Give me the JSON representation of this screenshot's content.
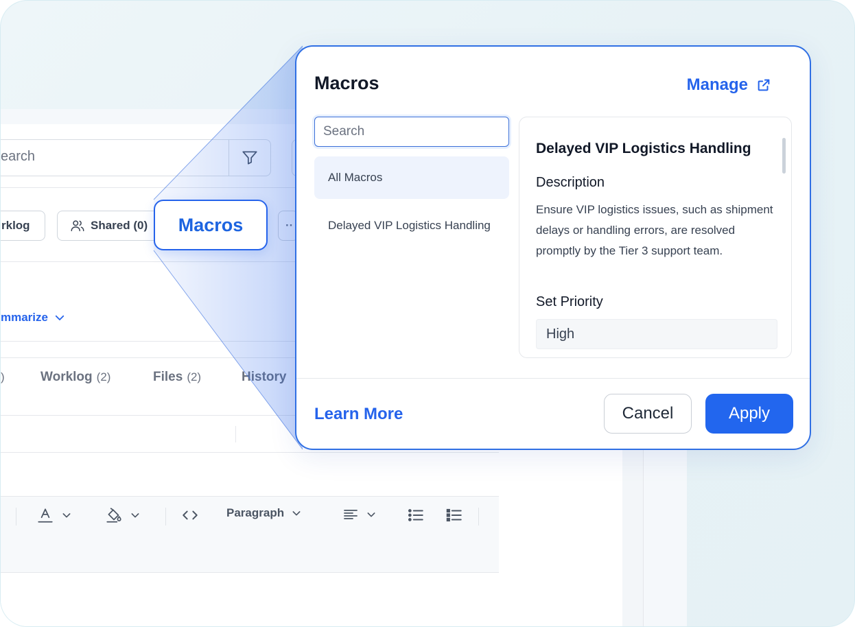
{
  "background": {
    "search_placeholder": "earch",
    "chips": {
      "worklog": "rklog",
      "shared": "Shared (0)",
      "more": "··"
    },
    "macros_callout": "Macros",
    "summarize": "mmarize",
    "tabs": [
      {
        "label": ")",
        "count": ""
      },
      {
        "label": "Worklog",
        "count": "(2)"
      },
      {
        "label": "Files",
        "count": "(2)"
      },
      {
        "label": "History",
        "count": ""
      }
    ],
    "toolbar": {
      "paragraph": "Paragraph"
    }
  },
  "modal": {
    "title": "Macros",
    "manage_label": "Manage",
    "search_placeholder": "Search",
    "list": [
      {
        "label": "All Macros",
        "active": true
      },
      {
        "label": "Delayed VIP Logistics Handling",
        "active": false
      }
    ],
    "detail": {
      "title": "Delayed VIP Logistics Handling",
      "description_label": "Description",
      "description": "Ensure VIP logistics issues, such as shipment delays or handling errors, are resolved promptly by the Tier 3 support team.",
      "priority_label": "Set Priority",
      "priority_value": "High"
    },
    "learn_more": "Learn More",
    "cancel_label": "Cancel",
    "apply_label": "Apply"
  },
  "colors": {
    "accent": "#2563eb",
    "apply_bg": "#2266ee",
    "active_item_bg": "#eef3fd"
  }
}
